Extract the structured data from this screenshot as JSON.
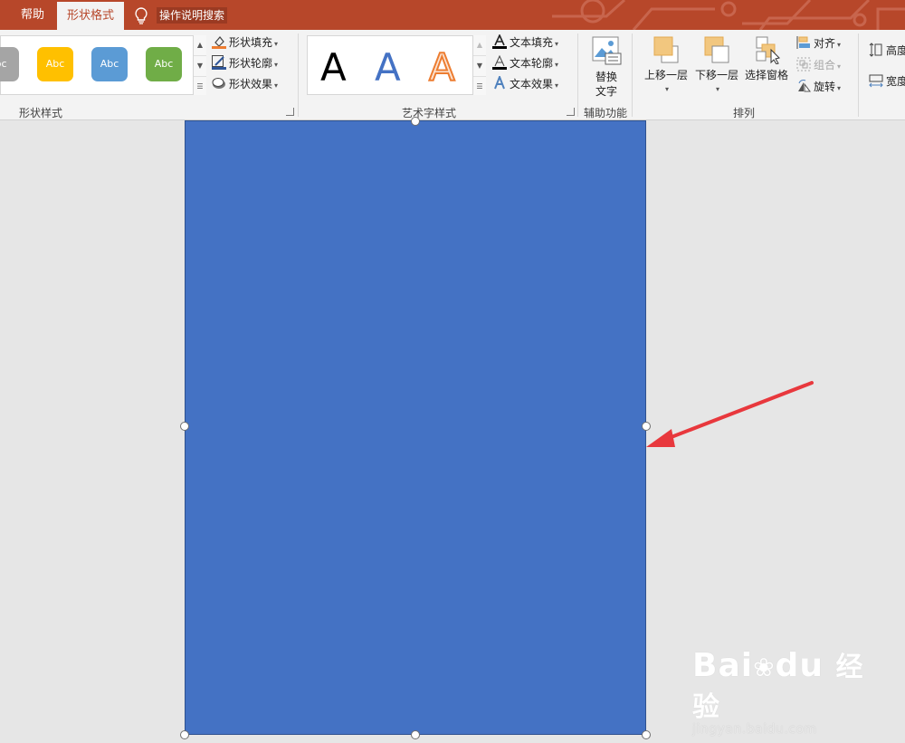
{
  "tabs": {
    "help": "帮助",
    "shape_format": "形状格式"
  },
  "search": {
    "label": "操作说明搜索"
  },
  "shape_styles": {
    "swatches": [
      {
        "label": "bc",
        "color": "#a5a5a5"
      },
      {
        "label": "Abc",
        "color": "#ffc000"
      },
      {
        "label": "Abc",
        "color": "#5b9bd5"
      },
      {
        "label": "Abc",
        "color": "#70ad47"
      }
    ],
    "fill": "形状填充",
    "outline": "形状轮廓",
    "effects": "形状效果",
    "group_label": "形状样式"
  },
  "wordart": {
    "letters": [
      {
        "char": "A",
        "color": "#000000",
        "outline": ""
      },
      {
        "char": "A",
        "color": "#4472c4",
        "outline": ""
      },
      {
        "char": "A",
        "color": "#ffffff",
        "outline": "#ed7d31"
      }
    ],
    "fill": "文本填充",
    "outline": "文本轮廓",
    "effects": "文本效果",
    "group_label": "艺术字样式"
  },
  "accessibility": {
    "alt_text_line1": "替换",
    "alt_text_line2": "文字",
    "group_label": "辅助功能"
  },
  "arrange": {
    "bring_forward": "上移一层",
    "send_backward": "下移一层",
    "selection_pane": "选择窗格",
    "align": "对齐",
    "group": "组合",
    "rotate": "旋转",
    "group_label": "排列"
  },
  "size": {
    "height": "高度",
    "width": "宽度"
  },
  "watermark": {
    "brand": "Bai",
    "brand2": "du",
    "suffix": "经验",
    "url": "jingyan.baidu.com"
  },
  "colors": {
    "accent": "#b7472a",
    "shape_fill": "#4472c4",
    "arrow": "#e8383d"
  }
}
